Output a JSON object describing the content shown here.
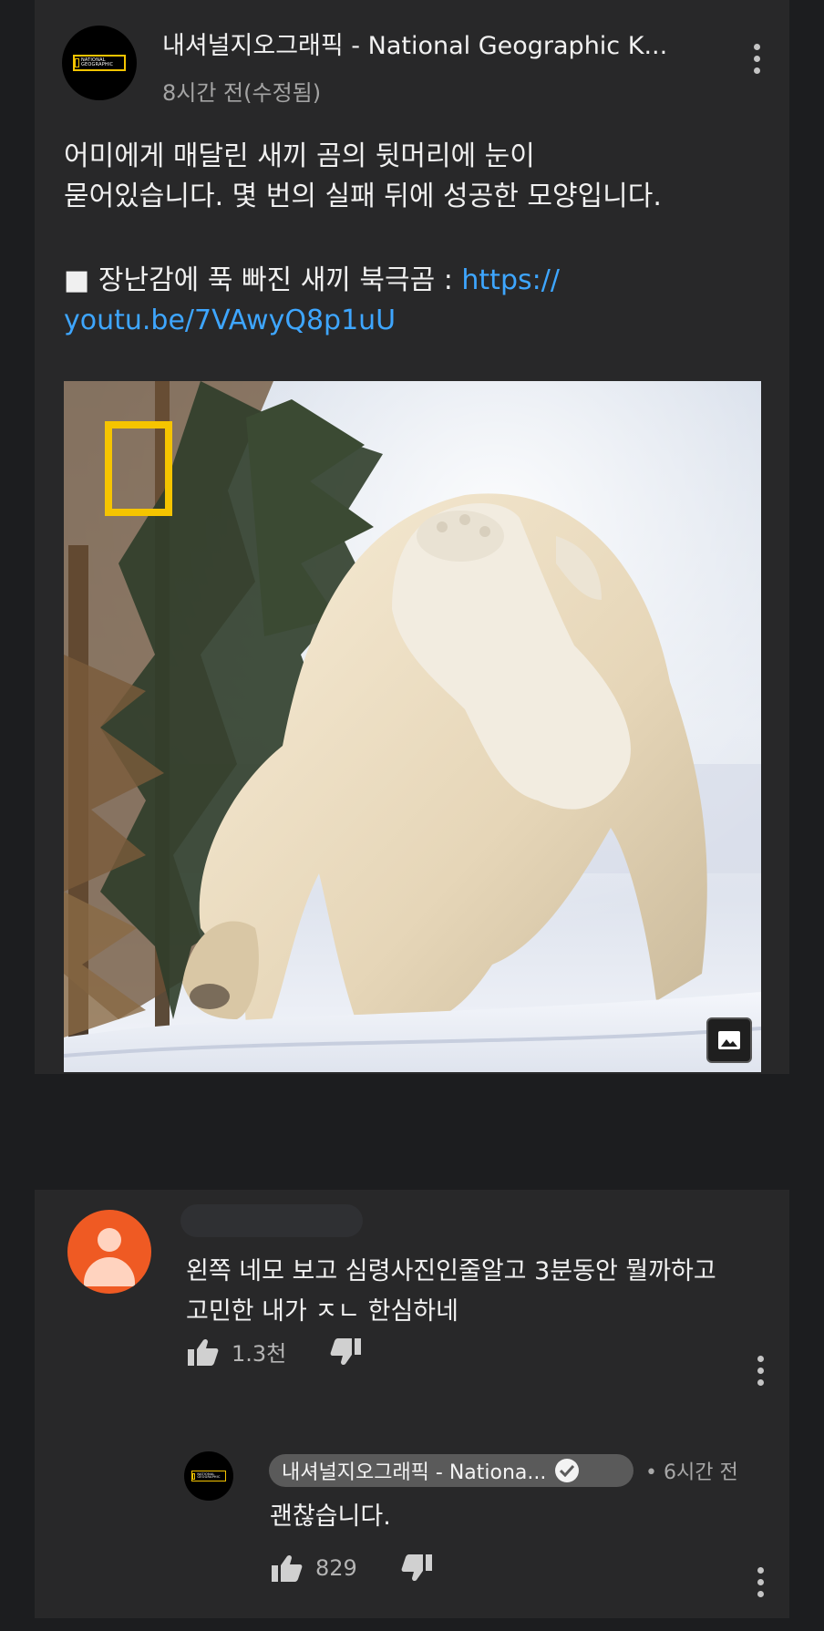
{
  "post": {
    "channel_name": "내셔널지오그래픽 - National Geographic K...",
    "timestamp": "8시간 전(수정됨)",
    "text_line1": "어미에게 매달린 새끼 곰의 뒷머리에 눈이",
    "text_line2": "묻어있습니다. 몇 번의 실패 뒤에 성공한 모양입니다.",
    "link_prefix": "■ 장난감에 푹 빠진 새끼 북극곰 : ",
    "link_part1": "https://",
    "link_part2": "youtu.be/7VAwyQ8p1uU",
    "logo_text": "NATIONAL GEOGRAPHIC"
  },
  "comment": {
    "text_line1": "왼쪽 네모 보고 심령사진인줄알고 3분동안 뭘까하고",
    "text_line2": "고민한 내가 ㅈㄴ 한심하네",
    "like_count": "1.3천"
  },
  "reply": {
    "author": "내셔널지오그래픽 - Nationa...",
    "time": "• 6시간 전",
    "text": "괜찮습니다.",
    "like_count": "829"
  },
  "colors": {
    "background": "#1c1d1f",
    "card": "#282829",
    "link": "#3ea6ff",
    "ng_yellow": "#f5c400",
    "avatar_orange": "#ef5a23"
  },
  "icons": [
    "more-vert-icon",
    "image-icon",
    "thumb-up-icon",
    "thumb-down-icon",
    "verified-check-icon"
  ]
}
